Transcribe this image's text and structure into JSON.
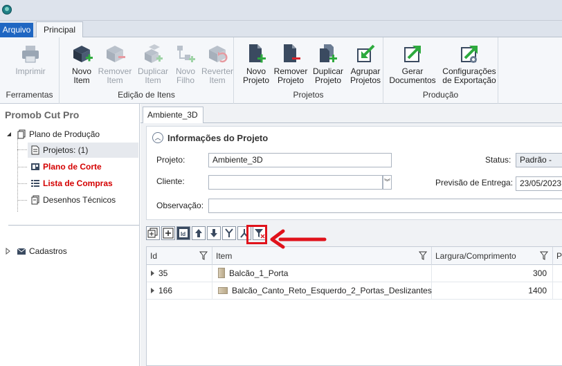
{
  "tabs": {
    "arquivo": "Arquivo",
    "principal": "Principal"
  },
  "ribbon": {
    "groups": {
      "ferramentas": "Ferramentas",
      "edicao": "Edição de Itens",
      "projetos": "Projetos",
      "producao": "Produção"
    },
    "buttons": {
      "imprimir": "Imprimir",
      "novo_item": "Novo\nItem",
      "remover_item": "Remover\nItem",
      "duplicar_item": "Duplicar\nItem",
      "novo_filho": "Novo\nFilho",
      "reverter_item": "Reverter\nItem",
      "novo_projeto": "Novo\nProjeto",
      "remover_projeto": "Remover\nProjeto",
      "duplicar_projeto": "Duplicar\nProjeto",
      "agrupar_projetos": "Agrupar\nProjetos",
      "gerar_documentos": "Gerar\nDocumentos",
      "config_exportacao": "Configurações\nde Exportação"
    }
  },
  "left_panel": {
    "title": "Promob Cut Pro",
    "tree": {
      "plano_producao": "Plano de Produção",
      "projetos": "Projetos: (1)",
      "plano_corte": "Plano de Corte",
      "lista_compras": "Lista de Compras",
      "desenhos": "Desenhos Técnicos",
      "cadastros": "Cadastros"
    }
  },
  "doc_tab": "Ambiente_3D",
  "info": {
    "title": "Informações do Projeto",
    "projeto_label": "Projeto:",
    "projeto_value": "Ambiente_3D",
    "cliente_label": "Cliente:",
    "cliente_value": "",
    "observacao_label": "Observação:",
    "observacao_value": "",
    "status_label": "Status:",
    "status_value": "Padrão - Eta",
    "previsao_label": "Previsão de Entrega:",
    "previsao_value": "23/05/2023"
  },
  "grid": {
    "columns": [
      "Id",
      "Item",
      "Largura/Comprimento",
      "P"
    ],
    "rows": [
      {
        "id": "35",
        "item": "Balcão_1_Porta",
        "largura": "300"
      },
      {
        "id": "166",
        "item": "Balcão_Canto_Reto_Esquerdo_2_Portas_Deslizantes",
        "largura": "1400"
      }
    ]
  },
  "colors": {
    "accent": "#1f66c2",
    "highlight": "#e0121b",
    "tree_red": "#d40000"
  }
}
